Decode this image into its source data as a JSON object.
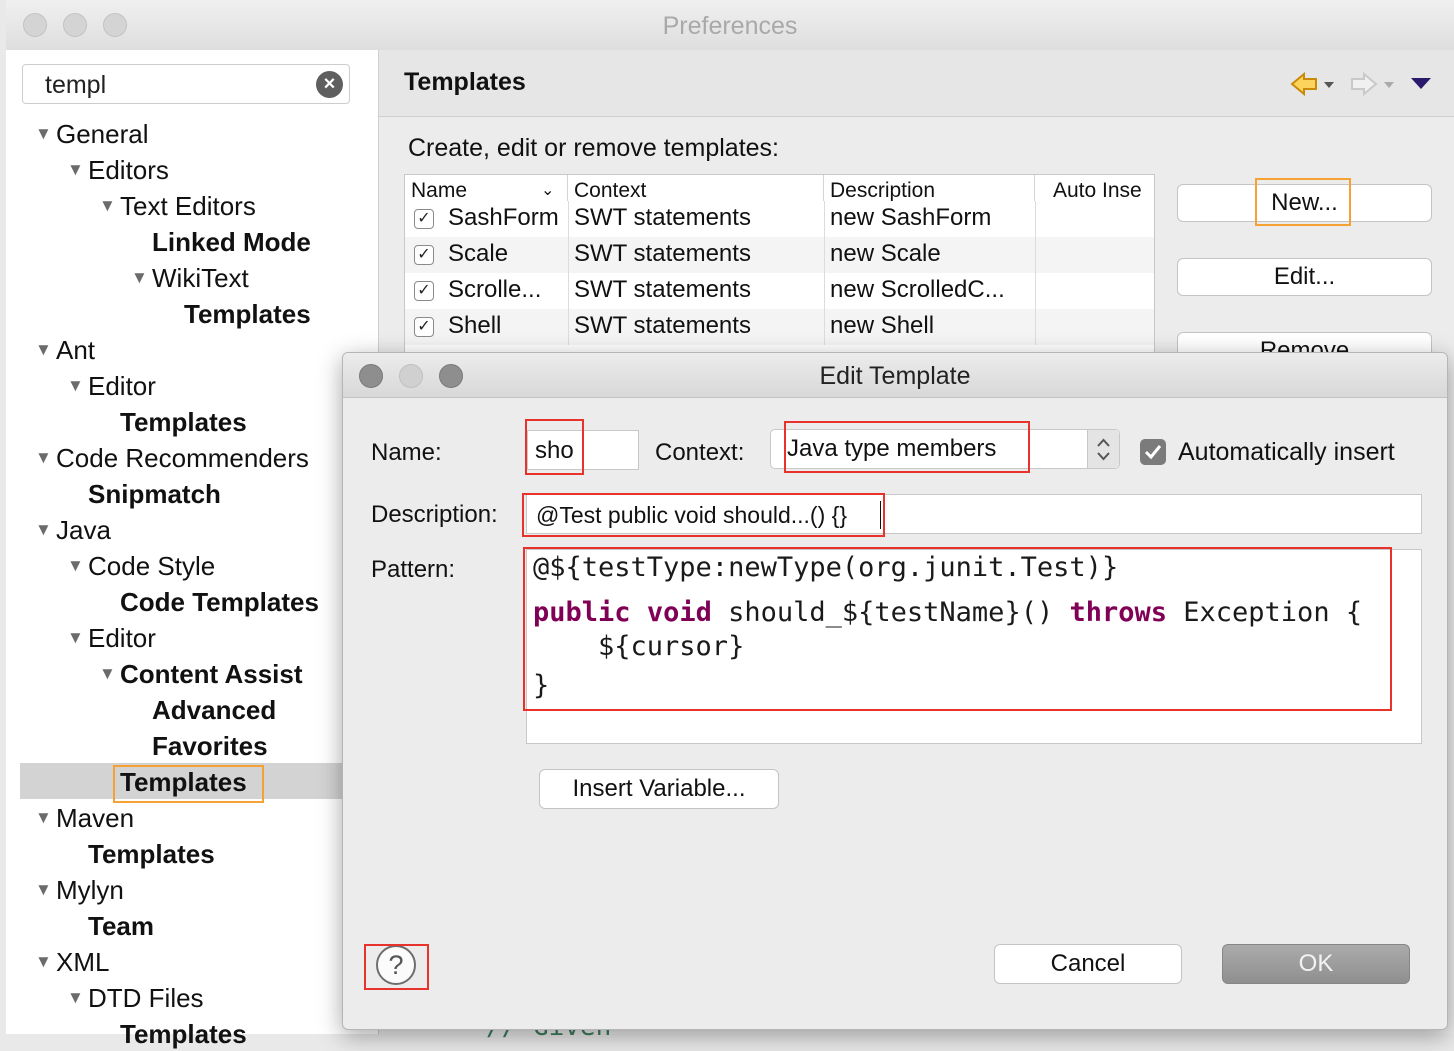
{
  "pref_window": {
    "title": "Preferences",
    "filter_value": "templ",
    "tree": [
      {
        "label": "General",
        "bold": false
      },
      {
        "label": "Editors",
        "bold": false
      },
      {
        "label": "Text Editors",
        "bold": false
      },
      {
        "label": "Linked Mode",
        "bold": true
      },
      {
        "label": "WikiText",
        "bold": false
      },
      {
        "label": "Templates",
        "bold": true
      },
      {
        "label": "Ant",
        "bold": false
      },
      {
        "label": "Editor",
        "bold": false
      },
      {
        "label": "Templates",
        "bold": true
      },
      {
        "label": "Code Recommenders",
        "bold": false
      },
      {
        "label": "Snipmatch",
        "bold": true
      },
      {
        "label": "Java",
        "bold": false
      },
      {
        "label": "Code Style",
        "bold": false
      },
      {
        "label": "Code Templates",
        "bold": true
      },
      {
        "label": "Editor",
        "bold": false
      },
      {
        "label": "Content Assist",
        "bold": true
      },
      {
        "label": "Advanced",
        "bold": true
      },
      {
        "label": "Favorites",
        "bold": true
      },
      {
        "label": "Templates",
        "bold": true
      },
      {
        "label": "Maven",
        "bold": false
      },
      {
        "label": "Templates",
        "bold": true
      },
      {
        "label": "Mylyn",
        "bold": false
      },
      {
        "label": "Team",
        "bold": true
      },
      {
        "label": "XML",
        "bold": false
      },
      {
        "label": "DTD Files",
        "bold": false
      },
      {
        "label": "Templates",
        "bold": true
      }
    ],
    "page_title": "Templates",
    "intro": "Create, edit or remove templates:",
    "table": {
      "columns": [
        "Name",
        "Context",
        "Description",
        "Auto Inse"
      ],
      "rows": [
        {
          "name": "SashForm",
          "context": "SWT statements",
          "description": "new SashForm",
          "checked": true
        },
        {
          "name": "Scale",
          "context": "SWT statements",
          "description": "new Scale",
          "checked": true
        },
        {
          "name": "Scrolle...",
          "context": "SWT statements",
          "description": "new ScrolledC...",
          "checked": true
        },
        {
          "name": "Shell",
          "context": "SWT statements",
          "description": "new Shell",
          "checked": true
        }
      ]
    },
    "buttons": {
      "new": "New...",
      "edit": "Edit...",
      "remove": "Remove"
    },
    "background_code_hint": "// Given"
  },
  "dialog": {
    "title": "Edit Template",
    "name_label": "Name:",
    "name_value": "sho",
    "context_label": "Context:",
    "context_value": "Java type members",
    "auto_insert_label": "Automatically insert",
    "description_label": "Description:",
    "description_value": "@Test public void should...() {}",
    "pattern_label": "Pattern:",
    "pattern": {
      "line1": "@${testType:newType(org.junit.Test)}",
      "kw_public": "public",
      "kw_void": "void",
      "line2_mid": " should_${testName}() ",
      "kw_throws": "throws",
      "line2_end": " Exception {",
      "line3": "    ${cursor}",
      "line4": "}"
    },
    "insert_variable": "Insert Variable...",
    "cancel": "Cancel",
    "ok": "OK",
    "help_glyph": "?"
  },
  "colors": {
    "annotation_red": "#e8332c",
    "annotation_orange": "#f5a133",
    "keyword": "#7f0055"
  }
}
